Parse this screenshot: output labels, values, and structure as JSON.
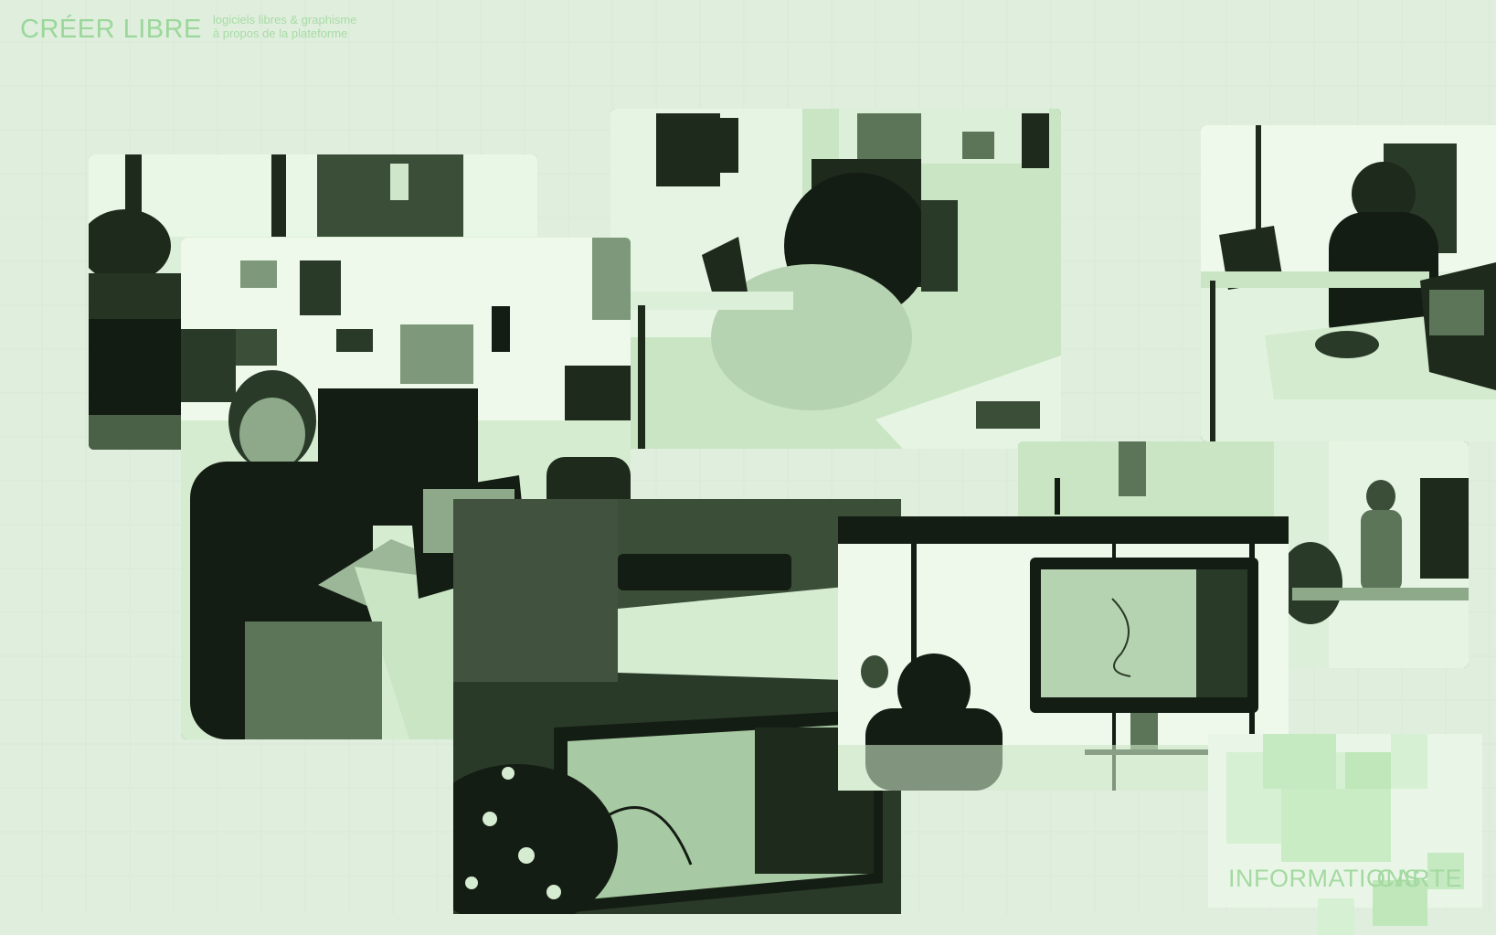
{
  "header": {
    "brand": "CRÉER LIBRE",
    "links": [
      "logiciels libres & graphisme",
      "à propos de la plateforme"
    ]
  },
  "footer": {
    "info": "INFORMATIONS",
    "map": "CARTE"
  },
  "colors": {
    "background": "#f3fbf1",
    "accent": "#9bd79b",
    "photo_tint_dark": "#1e2a1c",
    "photo_tint_light": "#cfeecb"
  },
  "photos": [
    "workshop-photo-man-laptop-left",
    "workshop-photo-person-at-desk",
    "workshop-photo-person-window",
    "workshop-photo-smiling-man-thumbs-up",
    "workshop-photo-laptop-closeup",
    "workshop-photo-man-standing-screen",
    "workshop-photo-big-screen-drawing"
  ]
}
